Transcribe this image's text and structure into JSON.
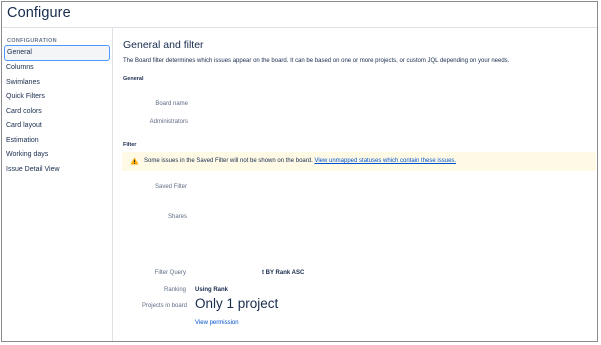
{
  "header": {
    "title": "Configure"
  },
  "sidebar": {
    "heading": "CONFIGURATION",
    "items": [
      {
        "label": "General"
      },
      {
        "label": "Columns"
      },
      {
        "label": "Swimlanes"
      },
      {
        "label": "Quick Filters"
      },
      {
        "label": "Card colors"
      },
      {
        "label": "Card layout"
      },
      {
        "label": "Estimation"
      },
      {
        "label": "Working days"
      },
      {
        "label": "Issue Detail View"
      }
    ]
  },
  "main": {
    "title": "General and filter",
    "description": "The Board filter determines which issues appear on the board. It can be based on one or more projects, or custom JQL depending on your needs.",
    "general": {
      "heading": "General",
      "board_name_label": "Board name",
      "administrators_label": "Administrators"
    },
    "filter": {
      "heading": "Filter",
      "warning_text": "Some issues in the Saved Filter will not be shown on the board.",
      "warning_link": "View unmapped statuses which contain these issues.",
      "saved_filter_label": "Saved Filter",
      "shares_label": "Shares",
      "filter_query_label": "Filter Query",
      "filter_query_value": "t BY Rank ASC",
      "ranking_label": "Ranking",
      "ranking_value": "Using Rank",
      "projects_label": "Projects in board",
      "projects_value": "Only 1 project",
      "view_permission_link": "View permission"
    }
  },
  "colors": {
    "accent": "#0052cc",
    "active_border": "#4c9aff",
    "warning_bg": "#fffae6",
    "warning_icon": "#ffab00"
  }
}
